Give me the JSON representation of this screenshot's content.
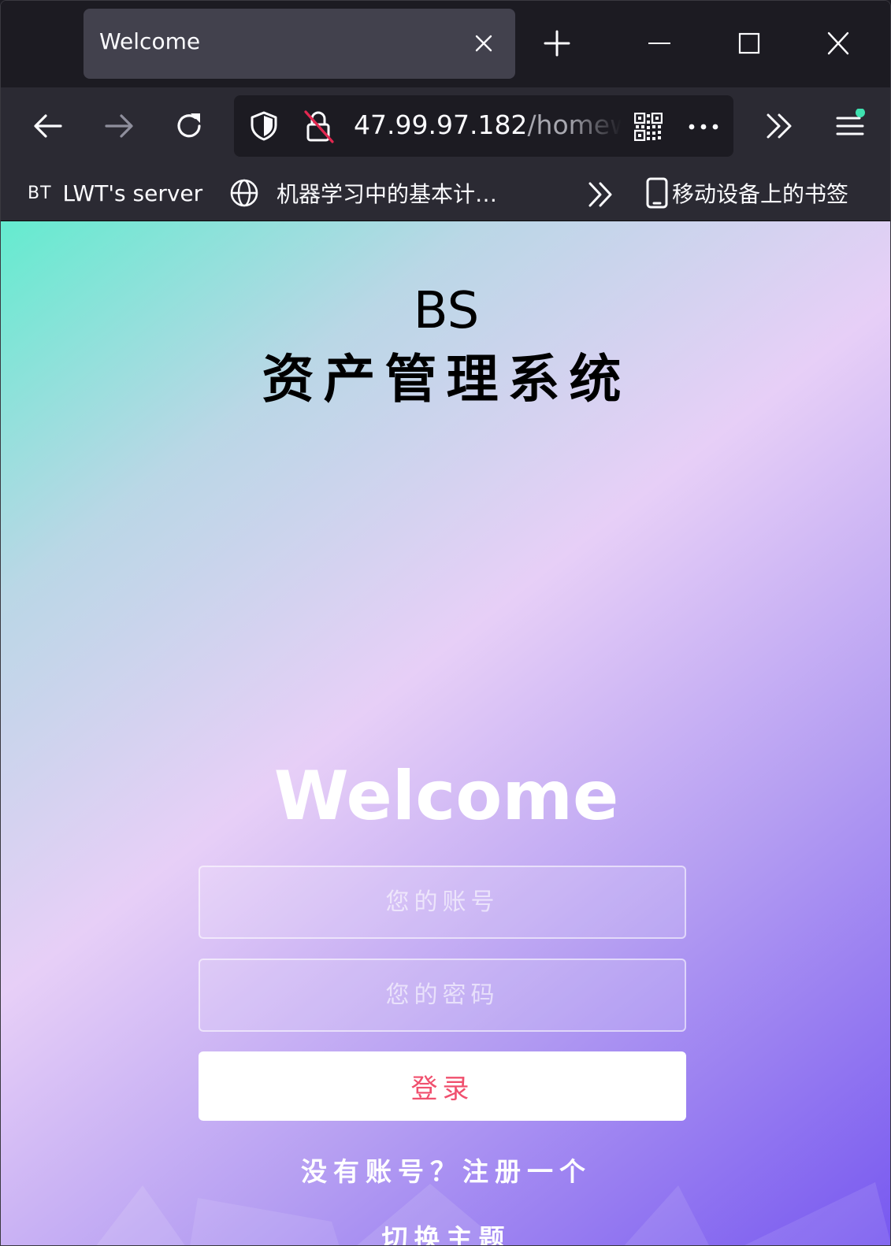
{
  "browser": {
    "tab": {
      "title": "Welcome"
    },
    "url": {
      "host": "47.99.97.182",
      "path": "/homew"
    },
    "bookmarks": [
      {
        "label": "LWT's server",
        "icon_text": "BT"
      },
      {
        "label": "机器学习中的基本计…",
        "icon": "globe-icon"
      }
    ],
    "mobile_bookmarks_label": "移动设备上的书签"
  },
  "page": {
    "brand": "BS",
    "system_title": "资产管理系统",
    "welcome": "Welcome",
    "username_placeholder": "您的账号",
    "password_placeholder": "您的密码",
    "login_label": "登录",
    "register_link": "没有账号？注册一个",
    "theme_link": "切换主题"
  },
  "colors": {
    "gradient": [
      "#64ebcf",
      "#bad7e6",
      "#e7cff7",
      "#b49df2",
      "#7758f0"
    ],
    "login_text": "#f0506e",
    "notification_dot": "#3fe1b0"
  }
}
